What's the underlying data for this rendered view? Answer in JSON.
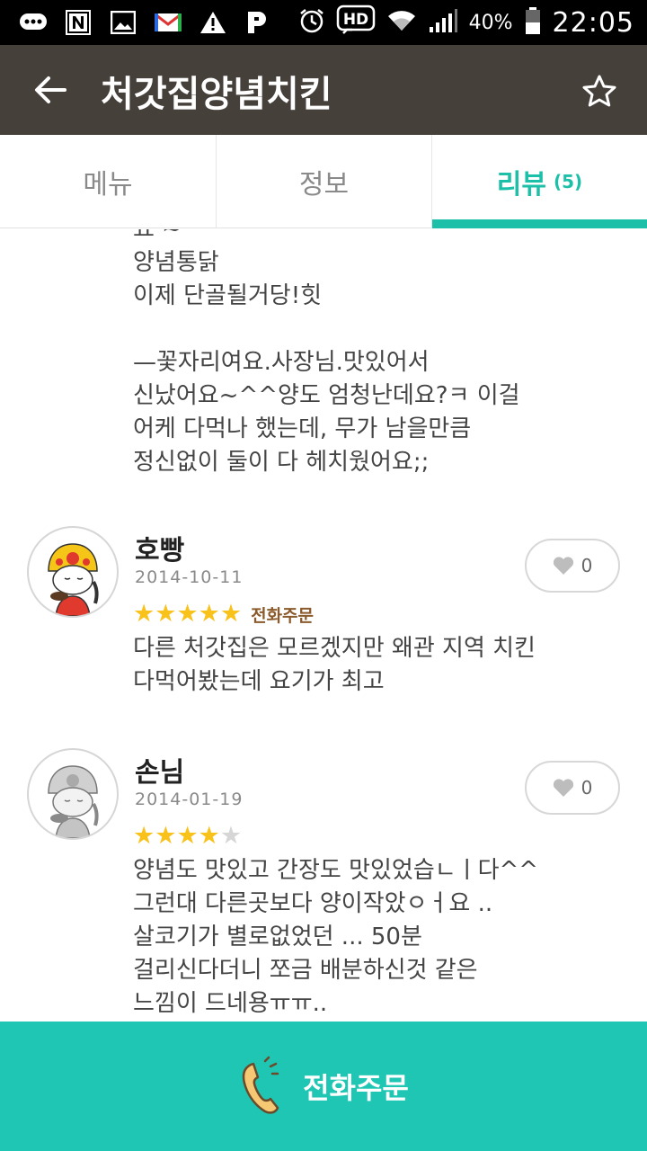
{
  "status_bar": {
    "battery_percent": "40%",
    "time": "22:05",
    "hd_label": "HD",
    "notification_icons": [
      "chat-icon",
      "n-icon",
      "image-icon",
      "mail-icon",
      "warning-icon",
      "p-icon"
    ],
    "system_icons": [
      "alarm-icon",
      "hd-icon",
      "wifi-icon",
      "signal-icon",
      "battery-icon"
    ]
  },
  "app_bar": {
    "title": "처갓집양념치킨",
    "back_icon": "arrow-left-icon",
    "favorite_icon": "star-outline-icon"
  },
  "tabs": [
    {
      "label": "메뉴",
      "active": false
    },
    {
      "label": "정보",
      "active": false
    },
    {
      "label": "리뷰",
      "count": "(5)",
      "active": true
    }
  ],
  "partial_review": {
    "text": "요 ~\n양념통닭\n이제 단골될거당!힛\n\n—꽃자리여요.사장님.맛있어서\n신났어요~^^양도 엄청난데요?ㅋ  이걸\n어케 다먹나 했는데, 무가 남을만큼\n정신없이 둘이 다 헤치웠어요;;"
  },
  "reviews": [
    {
      "name": "호빵",
      "date": "2014-10-11",
      "rating": 5,
      "order_type": "전화주문",
      "likes": "0",
      "text": "다른 처갓집은 모르겠지만 왜관 지역 치킨\n다먹어봤는데 요기가 최고",
      "avatar": "colored-character-avatar"
    },
    {
      "name": "손님",
      "date": "2014-01-19",
      "rating": 4,
      "order_type": "",
      "likes": "0",
      "text": "양념도 맛있고 간장도 맛있었습ㄴㅣ다^^\n그런대 다른곳보다 양이작았ㅇㅓ요 ..\n살코기가 별로없었던 ... 50분\n걸리신다더니 쪼금 배분하신것 같은\n느낌이 드네용ㅠㅠ..",
      "avatar": "grey-character-avatar"
    }
  ],
  "call_button": {
    "label": "전화주문",
    "icon": "phone-icon"
  },
  "colors": {
    "accent": "#1cbfa8",
    "app_bar": "#46403b",
    "star": "#f9c21a",
    "call_bar": "#1ec6b3"
  }
}
